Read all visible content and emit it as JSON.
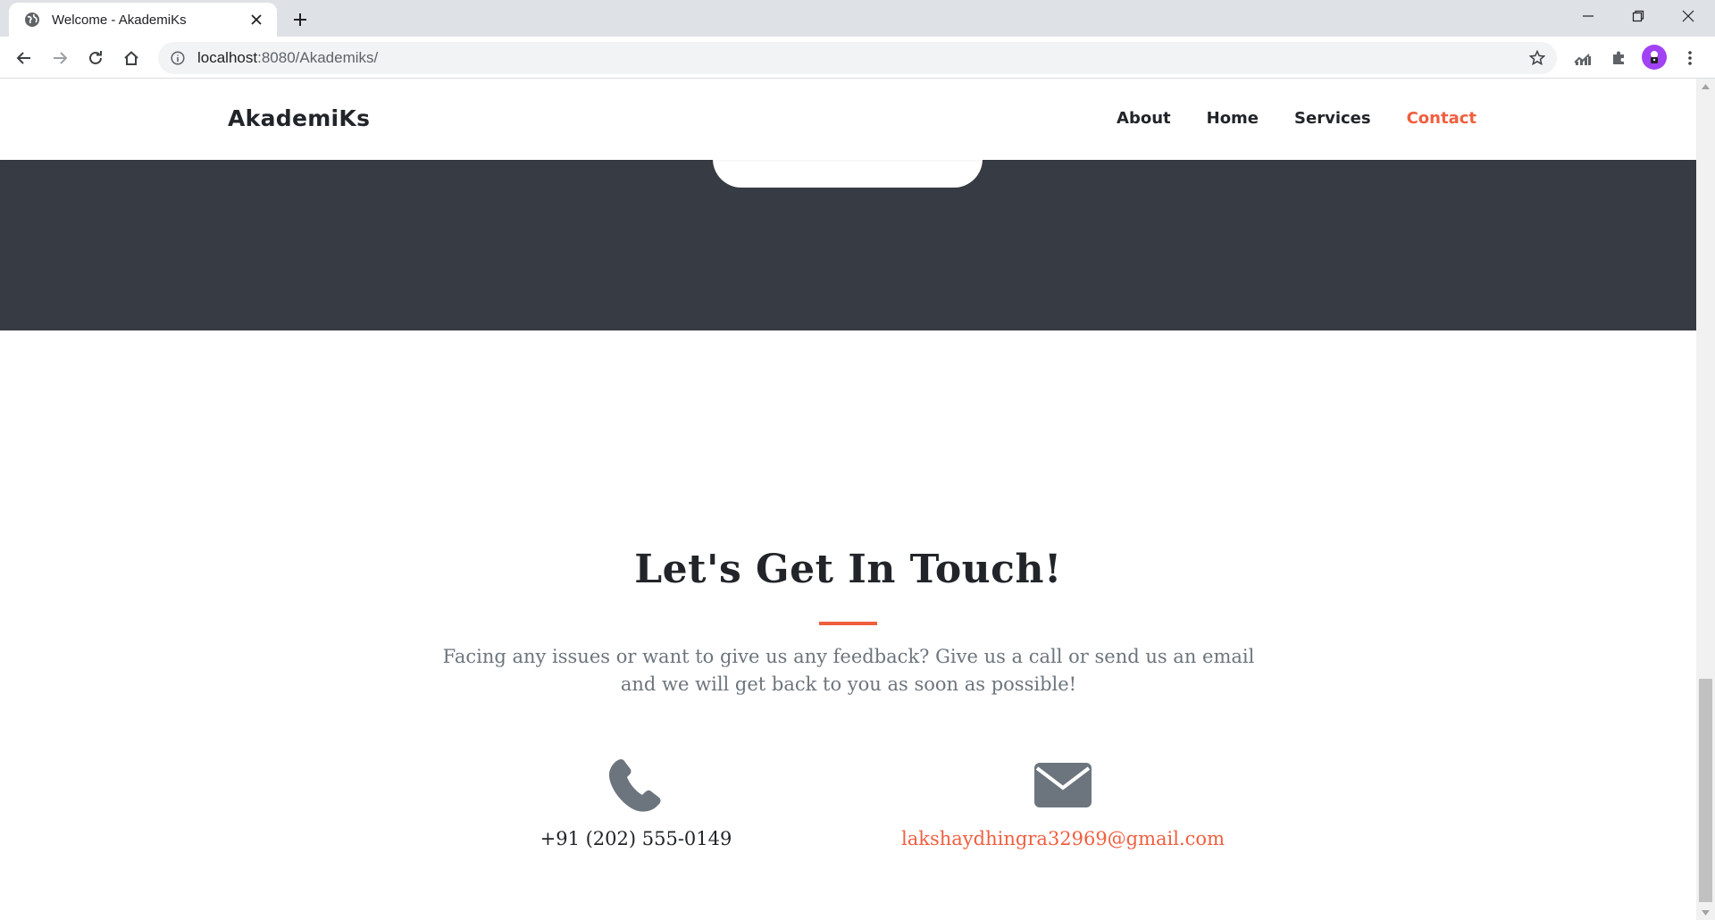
{
  "browser": {
    "tab_title": "Welcome - AkademiKs",
    "url_host": "localhost",
    "url_path": ":8080/Akademiks/"
  },
  "site": {
    "brand": "AkademiKs",
    "nav": [
      {
        "label": "About",
        "active": false
      },
      {
        "label": "Home",
        "active": false
      },
      {
        "label": "Services",
        "active": false
      },
      {
        "label": "Contact",
        "active": true
      }
    ]
  },
  "contact": {
    "title": "Let's Get In Touch!",
    "lead": "Facing any issues or want to give us any feedback? Give us a call or send us an email and we will get back to you as soon as possible!",
    "phone": "+91 (202) 555-0149",
    "email": "lakshaydhingra32969@gmail.com"
  },
  "colors": {
    "accent": "#f05f40",
    "dark_band": "#373b43",
    "icon": "#6c757d"
  },
  "icons": {
    "phone": "phone-icon",
    "email": "envelope-icon"
  }
}
